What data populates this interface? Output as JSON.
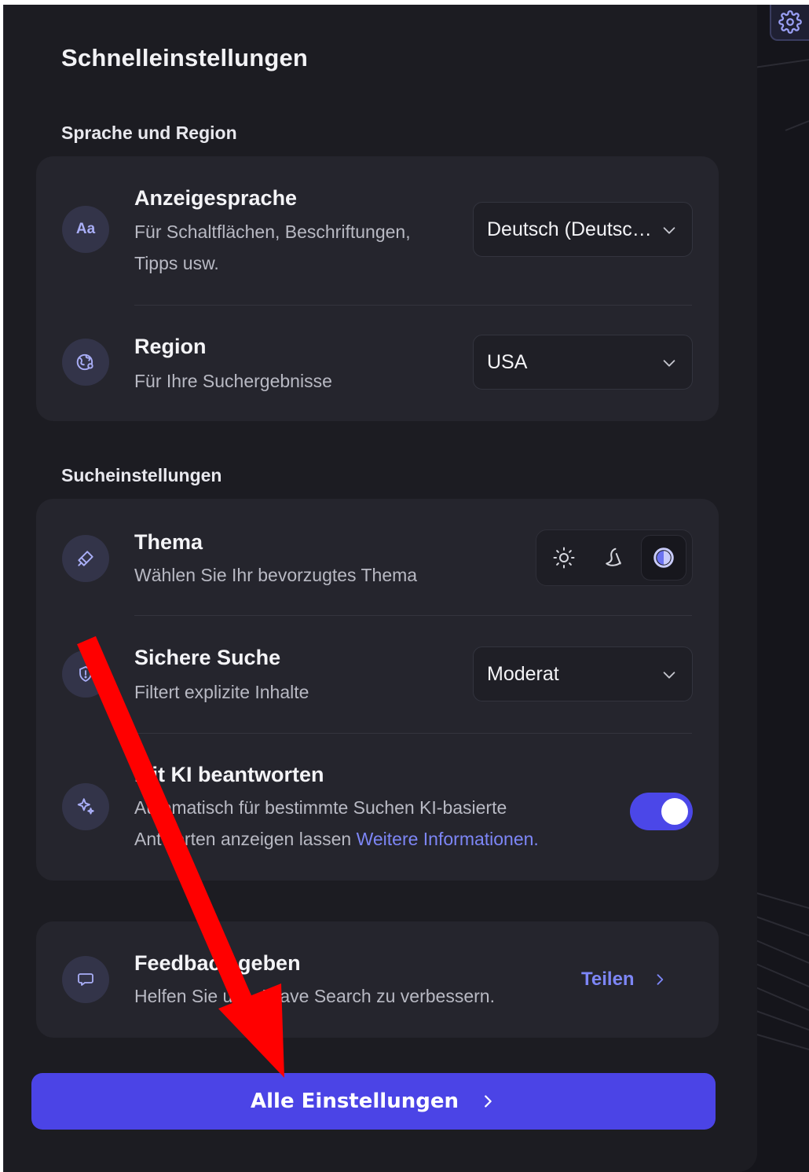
{
  "panel": {
    "title": "Schnelleinstellungen"
  },
  "sections": {
    "language_region": {
      "title": "Sprache und Region",
      "display_language": {
        "title": "Anzeigesprache",
        "description_line1": "Für Schaltflächen, Beschriftungen,",
        "description_line2": "Tipps usw.",
        "icon_text": "Aa",
        "selected": "Deutsch (Deutschland)"
      },
      "region": {
        "title": "Region",
        "description": "Für Ihre Suchergebnisse",
        "selected": "USA"
      }
    },
    "search_settings": {
      "title": "Sucheinstellungen",
      "theme": {
        "title": "Thema",
        "description": "Wählen Sie Ihr bevorzugtes Thema",
        "options": [
          "light",
          "dark",
          "system"
        ],
        "selected": "system"
      },
      "safe_search": {
        "title": "Sichere Suche",
        "description": "Filtert explizite Inhalte",
        "selected": "Moderat"
      },
      "ai_answers": {
        "title": "Mit KI beantworten",
        "description_line1": "Automatisch für bestimmte Suchen KI-basierte",
        "description_line2_prefix": "Antworten anzeigen lassen ",
        "more_info_link": "Weitere Informationen.",
        "enabled": true
      }
    },
    "feedback": {
      "title": "Feedback geben",
      "description": "Helfen Sie uns, Brave Search zu verbessern.",
      "action_label": "Teilen"
    }
  },
  "footer": {
    "all_settings_label": "Alle Einstellungen"
  },
  "colors": {
    "panel_bg": "#1c1c22",
    "card_bg": "#25252d",
    "accent": "#4b44e6",
    "link": "#7d86f6",
    "annotation_arrow": "#ff0000"
  },
  "icons": {
    "top_right": "gear-icon",
    "display_language": "language-aa-icon",
    "region": "globe-icon",
    "theme": "brush-icon",
    "safe_search": "shield-icon",
    "ai_answers": "sparkle-icon",
    "feedback": "chat-bubble-icon"
  }
}
